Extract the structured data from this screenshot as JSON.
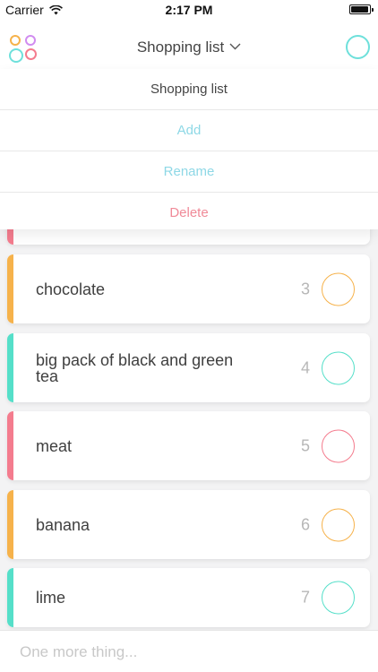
{
  "status_bar": {
    "carrier": "Carrier",
    "time": "2:17 PM",
    "battery_level": 0.95
  },
  "header": {
    "title": "Shopping list",
    "logo_colors": [
      "#f6b24b",
      "#d18cf0",
      "#6ee0db",
      "#f47c8e"
    ],
    "profile_color": "#6ee0db"
  },
  "dropdown": {
    "items": [
      {
        "label": "Shopping list",
        "color": "#444444"
      },
      {
        "label": "Add",
        "color": "#8ed8e6"
      },
      {
        "label": "Rename",
        "color": "#8ed8e6"
      },
      {
        "label": "Delete",
        "color": "#f08a98"
      }
    ]
  },
  "items": [
    {
      "name": "",
      "qty": "",
      "color": "#f47c8e"
    },
    {
      "name": "chocolate",
      "qty": "3",
      "color": "#f6b24b"
    },
    {
      "name": "big pack of black and green tea",
      "qty": "4",
      "color": "#55dfc9"
    },
    {
      "name": "meat",
      "qty": "5",
      "color": "#f47c8e"
    },
    {
      "name": "banana",
      "qty": "6",
      "color": "#f6b24b"
    },
    {
      "name": "lime",
      "qty": "7",
      "color": "#55dfc9"
    }
  ],
  "input": {
    "placeholder": "One more thing..."
  }
}
